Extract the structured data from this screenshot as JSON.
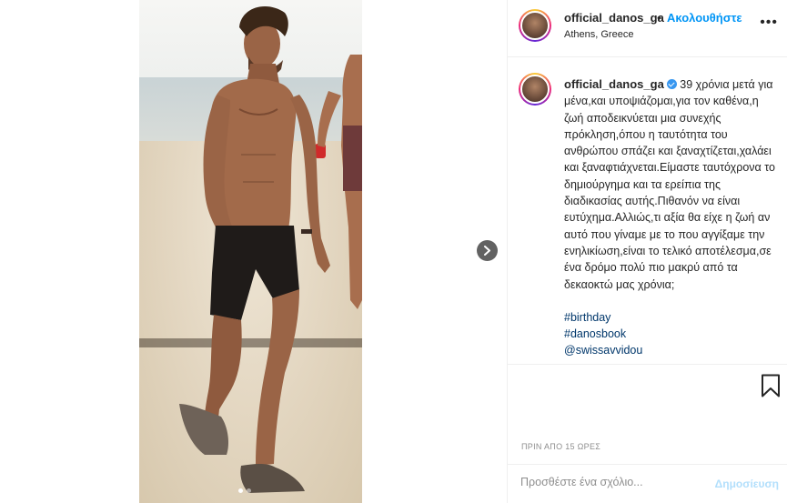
{
  "post": {
    "username": "official_danos_ga",
    "follow_label": "Ακολουθήστε",
    "separator": "•",
    "location": "Athens, Greece",
    "more_label": "•••",
    "caption": "39 χρόνια μετά για μένα,και υποψιάζομαι,για τον καθένα,η ζωή αποδεικνύεται μια συνεχής πρόκληση,όπου η ταυτότητα του ανθρώπου σπάζει και ξαναχτίζεται,χαλάει και ξαναφτιάχνεται.Είμαστε ταυτόχρονα το δημιούργημα και τα ερείπια της διαδικασίας αυτής.Πιθανόν να είναι ευτύχημα.Αλλιώς,τι αξία θα είχε η ζωή αν αυτό που γίναμε με το που αγγίξαμε την ενηλικίωση,είναι το τελικό αποτέλεσμα,σε ένα δρόμο πολύ πιο μακρύ από τα δεκαοκτώ μας χρόνια;",
    "hashtags": [
      "#birthday",
      "#danosbook",
      "@swissavvidou"
    ],
    "timestamp": "ΠΡΙΝ ΑΠΟ 15 ΩΡΕΣ",
    "comment_placeholder": "Προσθέστε ένα σχόλιο...",
    "post_button": "Δημοσίευση"
  },
  "carousel": {
    "slides": 2,
    "current": 1
  },
  "colors": {
    "accent": "#0095f6",
    "verified": "#3897f0",
    "hashtag": "#00376b",
    "muted": "#8e8e8e",
    "post_disabled": "#b2dffc"
  },
  "icons": {
    "next": "chevron-right-icon",
    "bookmark": "bookmark-icon",
    "verified": "verified-badge-icon"
  }
}
